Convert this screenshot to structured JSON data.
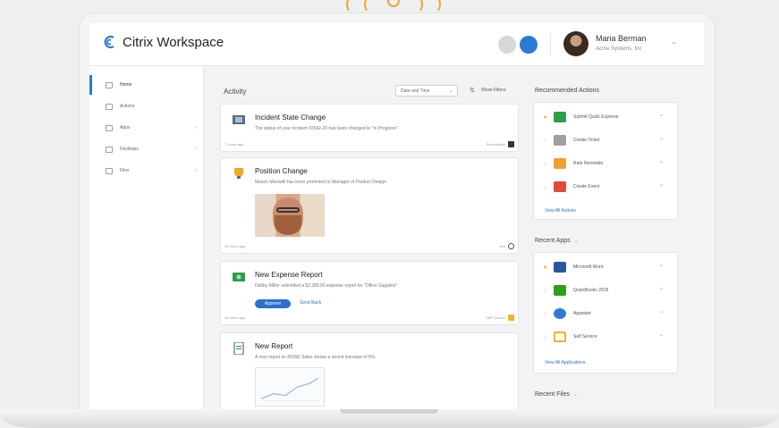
{
  "header": {
    "app_title": "Citrix Workspace",
    "user_name": "Maria Berman",
    "user_org": "Acme Systems, Inc"
  },
  "sidebar": {
    "items": [
      {
        "label": "Home"
      },
      {
        "label": "Actions"
      },
      {
        "label": "Apps"
      },
      {
        "label": "Desktops"
      },
      {
        "label": "Files"
      }
    ]
  },
  "activity": {
    "title": "Activity",
    "sort_value": "Date and Time",
    "show_filters": "Show Filters",
    "cards": [
      {
        "title": "Incident State Change",
        "description": "The status of your incident #2542-20 has been changed to \"In Progress\".",
        "time": "7 hours ago",
        "source": "ServiceNow",
        "icon": "incident-icon"
      },
      {
        "title": "Position Change",
        "description": "Mason Maxwell has been promoted to Manager of Product Design.",
        "time": "21 hours ago",
        "source": "Jive",
        "icon": "trophy-icon"
      },
      {
        "title": "New Expense Report",
        "description": "Debby Miller submitted a $2,389.00 expense report for \"Office Supplies\".",
        "approve_label": "Approve",
        "send_back_label": "Send Back",
        "time": "2d hours ago",
        "source": "SAP Concur",
        "icon": "expense-icon"
      },
      {
        "title": "New Report",
        "description": "A new report on ROSE Sales shows a recent increase of 5%.",
        "icon": "report-icon"
      }
    ]
  },
  "recommended_actions": {
    "title": "Recommended Actions",
    "items": [
      {
        "label": "Submit Quick Expense",
        "starred": true,
        "color": "#2e9e4a"
      },
      {
        "label": "Create Ticket",
        "starred": false,
        "color": "#9aa0a6"
      },
      {
        "label": "Rate Reminder",
        "starred": false,
        "color": "#f0a030"
      },
      {
        "label": "Create Event",
        "starred": false,
        "color": "#e04a3a"
      }
    ],
    "view_all": "View All Actions"
  },
  "recent_apps": {
    "title": "Recent Apps",
    "items": [
      {
        "label": "Microsoft Word",
        "starred": true,
        "color": "#2b579a"
      },
      {
        "label": "QuickBooks 2018",
        "starred": false,
        "color": "#2ca01c"
      },
      {
        "label": "Appstate",
        "starred": false,
        "color": "#2b7bd6"
      },
      {
        "label": "Self Service",
        "starred": false,
        "color": "#f0b429"
      }
    ],
    "view_all": "View All Applications"
  },
  "recent_files": {
    "title": "Recent Files"
  },
  "colors": {
    "accent": "#2b7bd6",
    "star": "#f5a623"
  }
}
